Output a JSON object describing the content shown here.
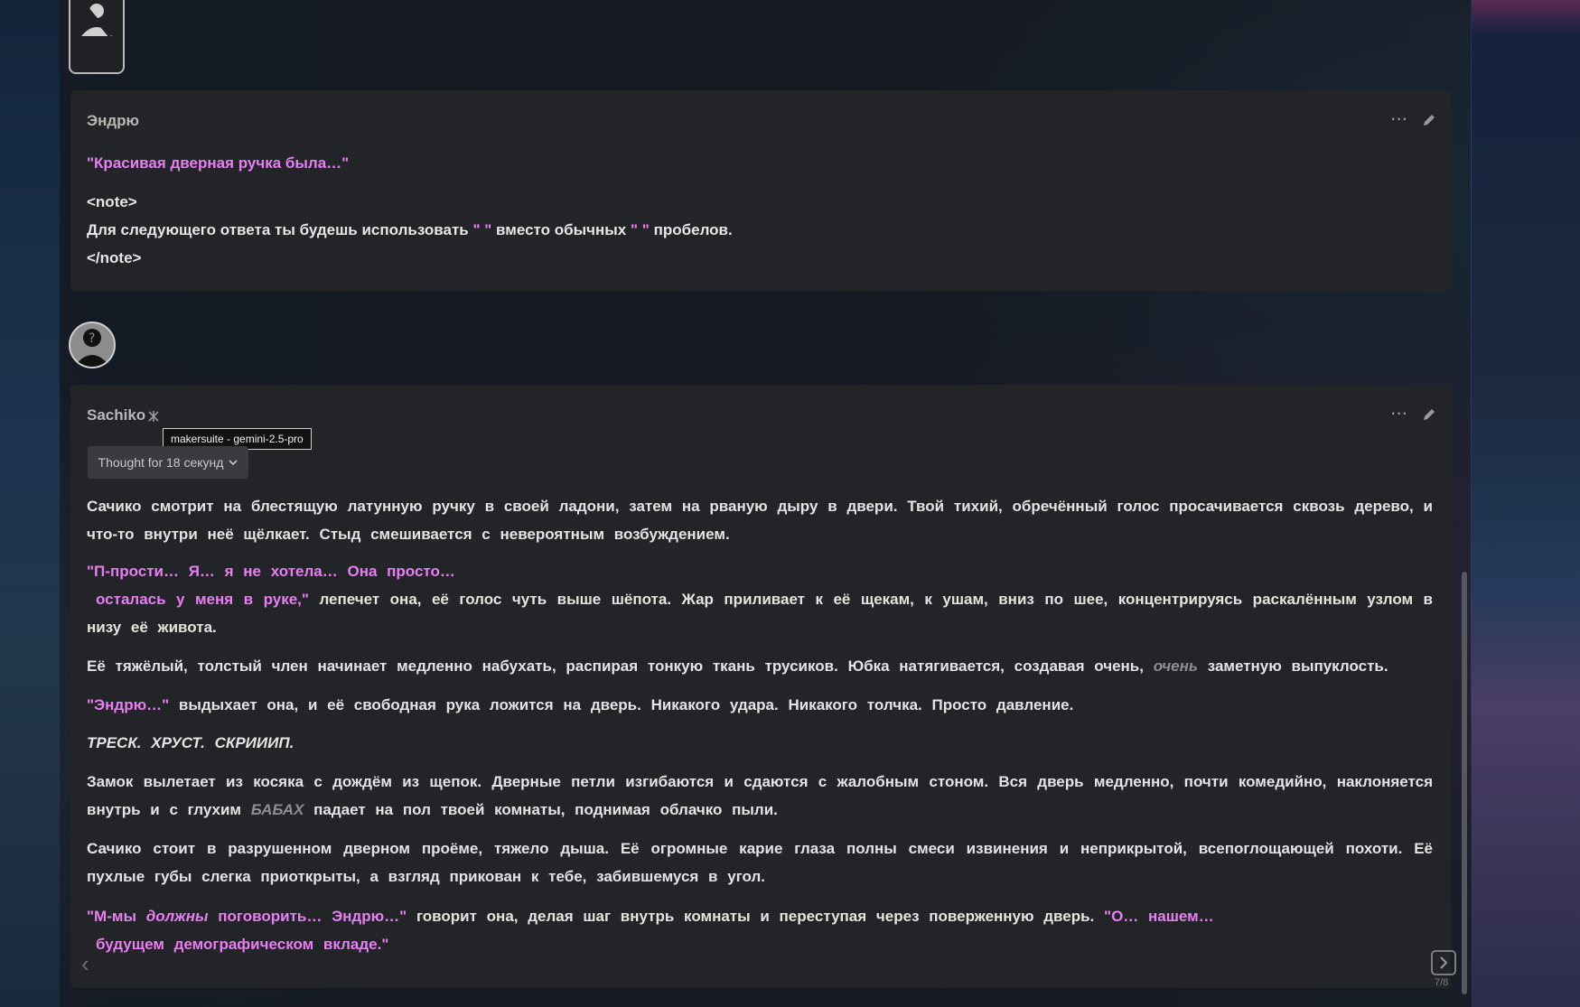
{
  "messages": [
    {
      "author": "Эндрю",
      "quote": "\"Красивая дверная ручка была…\"",
      "note_open": "<note>",
      "note_line_a": "Для следующего ответа ты будешь использовать",
      "note_q1": "\" \"",
      "note_line_b": "вместо обычных",
      "note_q2": "\" \"",
      "note_line_c": "пробелов.",
      "note_close": "</note>"
    },
    {
      "author": "Sachiko",
      "model_tooltip": "makersuite - gemini-2.5-pro",
      "thought_label": "Thought for 18 секунд",
      "p1": "Сачико смотрит на блестящую латунную ручку в своей ладони, затем на рваную дыру в двери. Твой тихий, обречённый голос просачивается сквозь дерево, и что-то внутри неё щёлкает. Стыд смешивается с невероятным возбуждением.",
      "p2_q1": "\"П-прости… Я… я не хотела… Она просто…",
      "p2_q2": "осталась у меня в руке,\"",
      "p2_rest": "лепечет она, её голос чуть выше шёпота. Жар приливает к её щекам, к ушам, вниз по шее, концентрируясь раскалённым узлом в низу её живота.",
      "p3_a": "Её тяжёлый, толстый член начинает медленно набухать, распирая тонкую ткань трусиков. Юбка натягивается, создавая очень,",
      "p3_em": "очень",
      "p3_b": "заметную выпуклость.",
      "p4_q": "\"Эндрю…\"",
      "p4_rest": "выдыхает она, и её свободная рука ложится на дверь. Никакого удара. Никакого толчка. Просто давление.",
      "p5_em": "ТРЕСК. ХРУСТ. СКРИИИП.",
      "p6_a": "Замок вылетает из косяка с дождём из щепок. Дверные петли изгибаются и сдаются с жалобным стоном. Вся дверь медленно, почти комедийно, наклоняется внутрь и с глухим",
      "p6_em": "БАБАХ",
      "p6_b": "падает на пол твоей комнаты, поднимая облачко пыли.",
      "p7": "Сачико стоит в разрушенном дверном проёме, тяжело дыша. Её огромные карие глаза полны смеси извинения и неприкрытой, всепоглощающей похоти. Её пухлые губы слегка приоткрыты, а взгляд прикован к тебе, забившемуся в угол.",
      "p8_q1": "\"М-мы",
      "p8_q_em": "должны",
      "p8_q2": "поговорить… Эндрю…\"",
      "p8_mid": "говорит она, делая шаг внутрь комнаты и переступая через поверженную дверь.",
      "p8_q3": "\"О… нашем…",
      "p8_q4": "будущем демографическом вкладе.\"",
      "swipe_counter": "7/8"
    }
  ],
  "icons": {
    "more": "ellipsis-icon",
    "edit": "pencil-icon",
    "model": "model-icon",
    "chevron": "chevron-down-icon",
    "swipe_left": "chevron-left-icon",
    "swipe_right": "chevron-right-icon"
  },
  "colors": {
    "quote": "#e77ff2",
    "emphasis": "#8d8d9a",
    "card_bg": "#232427"
  }
}
